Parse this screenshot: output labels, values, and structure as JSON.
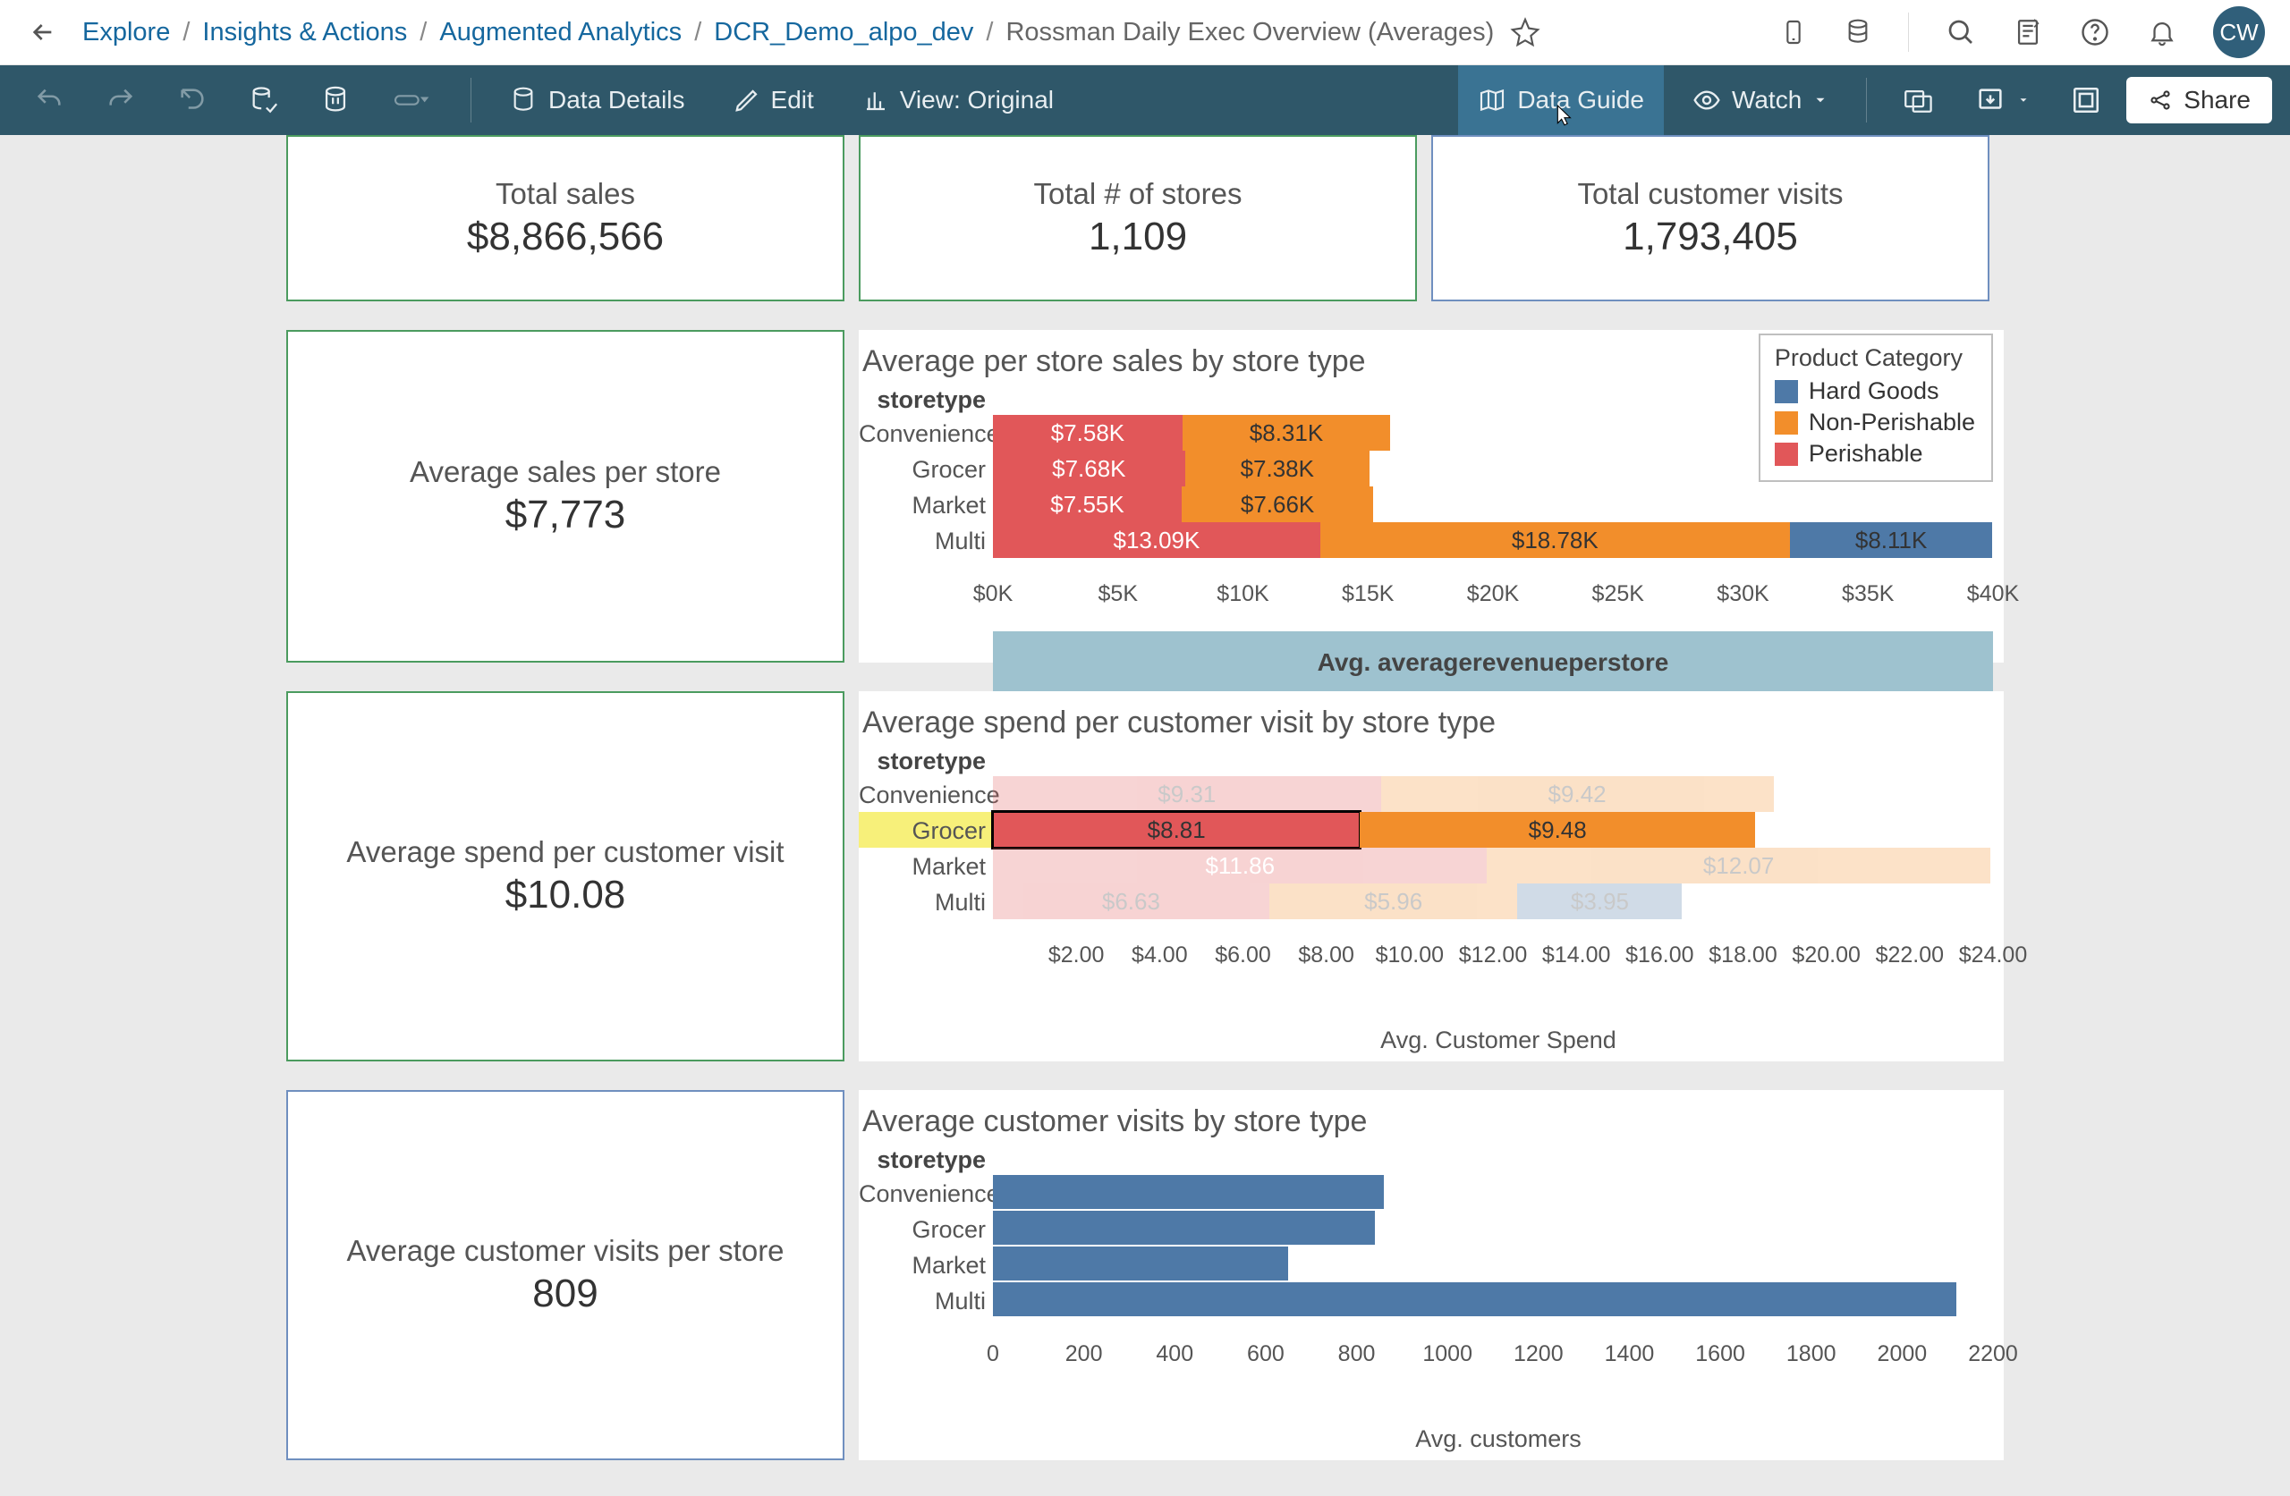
{
  "colors": {
    "hard": "#4e79a7",
    "nonp": "#f28e2b",
    "peri": "#e15759"
  },
  "header": {
    "breadcrumbs": [
      "Explore",
      "Insights & Actions",
      "Augmented Analytics",
      "DCR_Demo_alpo_dev"
    ],
    "current": "Rossman Daily Exec Overview (Averages)",
    "avatar": "CW"
  },
  "toolbar": {
    "data_details": "Data Details",
    "edit": "Edit",
    "view": "View: Original",
    "data_guide": "Data Guide",
    "watch": "Watch",
    "share": "Share"
  },
  "kpis": {
    "total_sales": {
      "title": "Total sales",
      "value": "$8,866,566"
    },
    "total_stores": {
      "title": "Total # of stores",
      "value": "1,109"
    },
    "total_visits": {
      "title": "Total customer visits",
      "value": "1,793,405"
    },
    "avg_sales": {
      "title": "Average sales per store",
      "value": "$7,773"
    },
    "avg_spend": {
      "title": "Average spend per customer visit",
      "value": "$10.08"
    },
    "avg_visits": {
      "title": "Average customer visits per store",
      "value": "809"
    }
  },
  "legend": {
    "title": "Product Category",
    "items": [
      "Hard Goods",
      "Non-Perishable",
      "Perishable"
    ]
  },
  "chart_data": [
    {
      "type": "bar",
      "title": "Average per store sales by store type",
      "ylabel_header": "storetype",
      "xlabel": "Avg. averagerevenueperstore",
      "xlim": [
        0,
        40000
      ],
      "xticks": [
        "$0K",
        "$5K",
        "$10K",
        "$15K",
        "$20K",
        "$25K",
        "$30K",
        "$35K",
        "$40K"
      ],
      "categories": [
        "Convenience",
        "Grocer",
        "Market",
        "Multi"
      ],
      "series": [
        {
          "name": "Perishable",
          "values": [
            7580,
            7680,
            7550,
            13090
          ],
          "labels": [
            "$7.58K",
            "$7.68K",
            "$7.55K",
            "$13.09K"
          ]
        },
        {
          "name": "Non-Perishable",
          "values": [
            8310,
            7380,
            7660,
            18780
          ],
          "labels": [
            "$8.31K",
            "$7.38K",
            "$7.66K",
            "$18.78K"
          ]
        },
        {
          "name": "Hard Goods",
          "values": [
            0,
            0,
            0,
            8110
          ],
          "labels": [
            "",
            "",
            "",
            "$8.11K"
          ]
        }
      ]
    },
    {
      "type": "bar",
      "title": "Average spend per customer visit by store type",
      "ylabel_header": "storetype",
      "xlabel": "Avg. Customer Spend",
      "xlim": [
        0,
        24
      ],
      "xticks": [
        "$2.00",
        "$4.00",
        "$6.00",
        "$8.00",
        "$10.00",
        "$12.00",
        "$14.00",
        "$16.00",
        "$18.00",
        "$20.00",
        "$22.00",
        "$24.00"
      ],
      "categories": [
        "Convenience",
        "Grocer",
        "Market",
        "Multi"
      ],
      "selected_category": "Grocer",
      "series": [
        {
          "name": "Perishable",
          "values": [
            9.31,
            8.81,
            11.86,
            6.63
          ],
          "labels": [
            "$9.31",
            "$8.81",
            "$11.86",
            "$6.63"
          ]
        },
        {
          "name": "Non-Perishable",
          "values": [
            9.42,
            9.48,
            12.07,
            5.96
          ],
          "labels": [
            "$9.42",
            "$9.48",
            "$12.07",
            "$5.96"
          ]
        },
        {
          "name": "Hard Goods",
          "values": [
            0,
            0,
            0,
            3.95
          ],
          "labels": [
            "",
            "",
            "",
            "$3.95"
          ]
        }
      ]
    },
    {
      "type": "bar",
      "title": "Average customer visits by store type",
      "ylabel_header": "storetype",
      "xlabel": "Avg. customers",
      "xlim": [
        0,
        2200
      ],
      "xticks": [
        "0",
        "200",
        "400",
        "600",
        "800",
        "1000",
        "1200",
        "1400",
        "1600",
        "1800",
        "2000",
        "2200"
      ],
      "categories": [
        "Convenience",
        "Grocer",
        "Market",
        "Multi"
      ],
      "series": [
        {
          "name": "customers",
          "values": [
            860,
            840,
            650,
            2120
          ]
        }
      ]
    }
  ]
}
